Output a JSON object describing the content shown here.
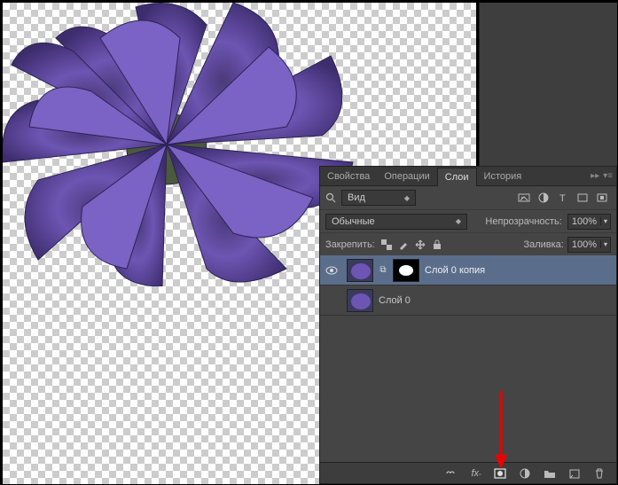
{
  "tabs": {
    "properties": "Свойства",
    "actions": "Операции",
    "layers": "Слои",
    "history": "История"
  },
  "filter": {
    "mode": "Вид"
  },
  "iconbar": {
    "i1": "image-filter-icon",
    "i2": "adjustments-icon",
    "i3": "type-icon",
    "i4": "crop-icon",
    "i5": "transform-icon"
  },
  "blend": {
    "mode": "Обычные",
    "opacity_label": "Непрозрачность:",
    "opacity": "100%"
  },
  "lock": {
    "label": "Закрепить:",
    "fill_label": "Заливка:",
    "fill": "100%"
  },
  "layers": [
    {
      "name": "Слой 0 копия",
      "visible": true,
      "mask": true
    },
    {
      "name": "Слой 0",
      "visible": false,
      "mask": false
    }
  ],
  "bottom_icons": {
    "link": "link-icon",
    "fx": "fx-icon",
    "mask": "mask-icon",
    "adjust": "adjustment-icon",
    "group": "group-icon",
    "new": "new-layer-icon",
    "trash": "trash-icon"
  }
}
